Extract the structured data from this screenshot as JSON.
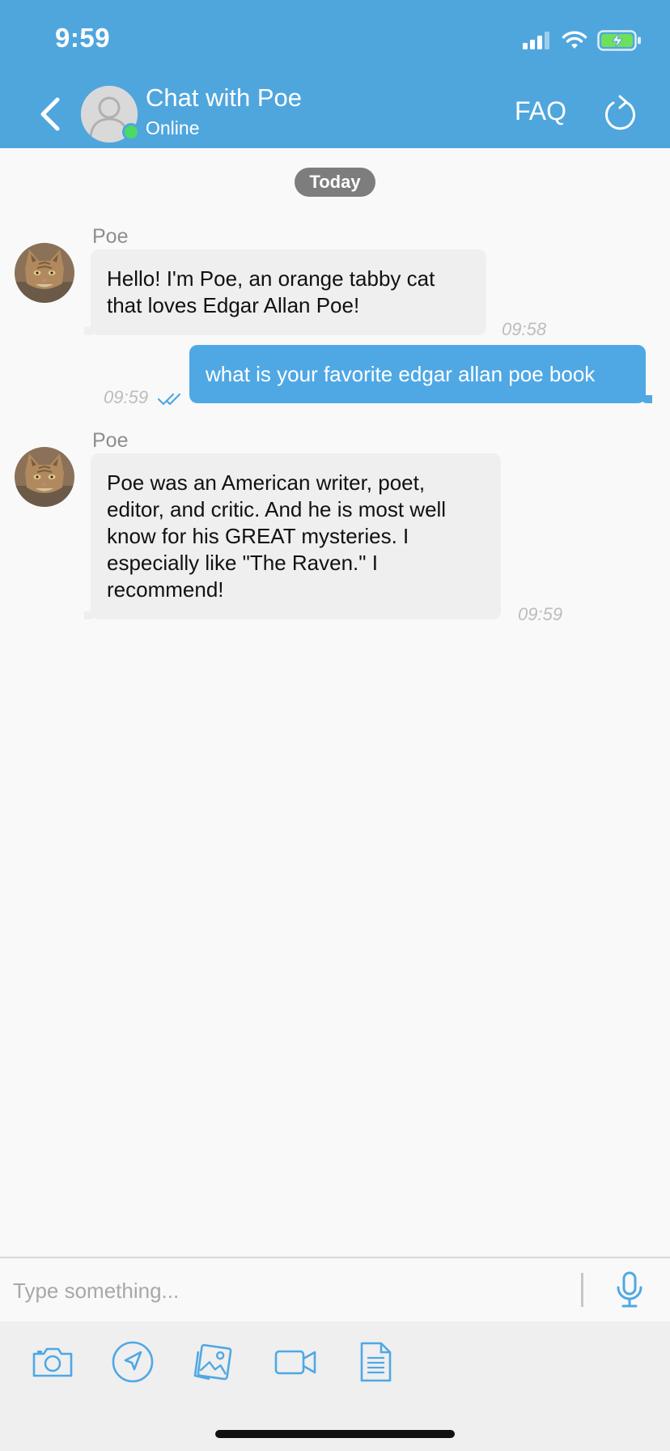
{
  "status_bar": {
    "time": "9:59"
  },
  "header": {
    "title": "Chat with Poe",
    "status": "Online",
    "faq_label": "FAQ",
    "icons": [
      "back-chevron",
      "user-placeholder",
      "refresh"
    ]
  },
  "colors": {
    "header_bg": "#4fa6dd",
    "outgoing_bubble": "#4fa8e4",
    "incoming_bubble": "#efefef",
    "online": "#4cd964",
    "icon_blue": "#4fa8e4"
  },
  "conversation": {
    "date_label": "Today",
    "messages": [
      {
        "direction": "incoming",
        "sender": "Poe",
        "text": "Hello! I'm Poe, an orange tabby cat that loves Edgar Allan Poe!",
        "time": "09:58"
      },
      {
        "direction": "outgoing",
        "text": "what is your favorite edgar allan poe book",
        "time": "09:59",
        "read": true
      },
      {
        "direction": "incoming",
        "sender": "Poe",
        "text": "Poe was an American writer, poet, editor, and critic. And he is most well know for his GREAT mysteries. I especially like \"The Raven.\" I recommend!",
        "time": "09:59"
      }
    ]
  },
  "composer": {
    "placeholder": "Type something...",
    "tools": [
      "camera",
      "location",
      "photos",
      "video",
      "document"
    ]
  }
}
